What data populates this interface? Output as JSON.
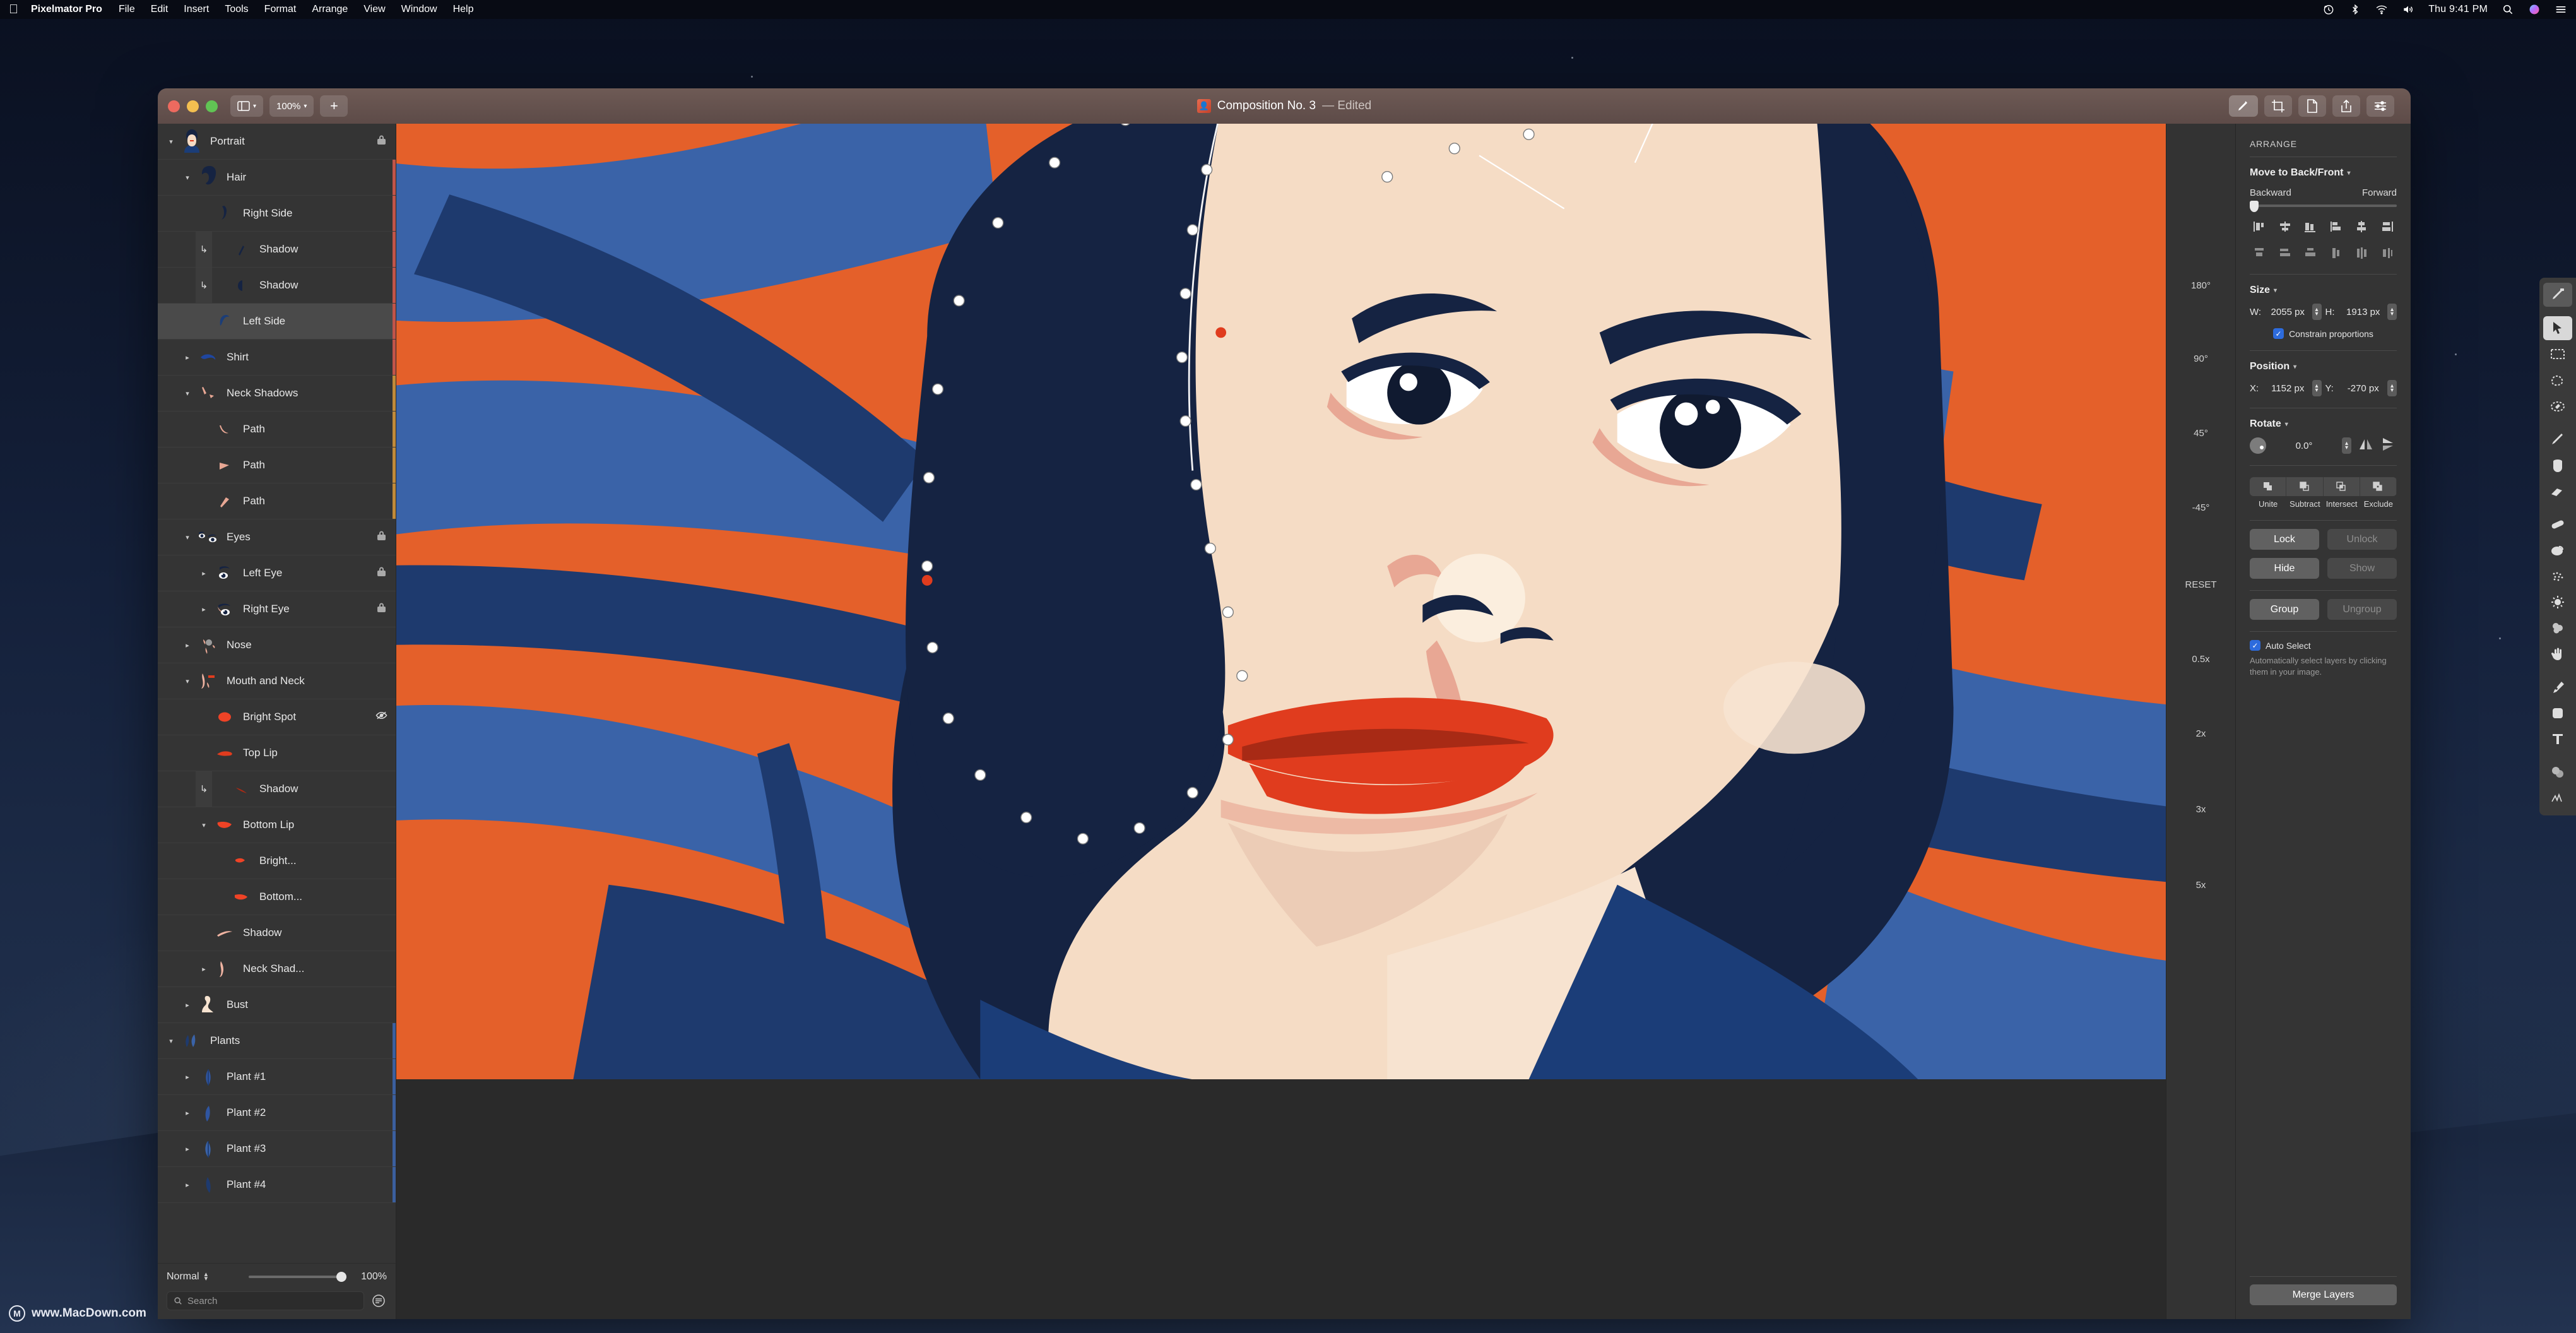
{
  "menubar": {
    "apple": "apple-logo",
    "app_name": "Pixelmator Pro",
    "items": [
      "File",
      "Edit",
      "Insert",
      "Tools",
      "Format",
      "Arrange",
      "View",
      "Window",
      "Help"
    ],
    "status_icons": [
      "time-machine-icon",
      "bluetooth-icon",
      "wifi-icon",
      "volume-icon"
    ],
    "clock": "Thu 9:41 PM",
    "right_icons": [
      "search-icon",
      "siri-icon",
      "control-center-icon"
    ]
  },
  "titlebar": {
    "view_button": "sidebar-toggle",
    "zoom_label": "100%",
    "add_label": "+",
    "doc_name": "Composition No. 3",
    "doc_state": "— Edited",
    "tools": [
      "paint-tool-icon",
      "crop-icon",
      "document-icon",
      "share-icon",
      "sliders-icon"
    ]
  },
  "layers": {
    "rows": [
      {
        "name": "Portrait",
        "indent": 0,
        "disclosure": "down",
        "thumb": "portrait",
        "badge": "lock",
        "clip": false,
        "selected": false,
        "bar": ""
      },
      {
        "name": "Hair",
        "indent": 1,
        "disclosure": "down",
        "thumb": "hair",
        "badge": "",
        "clip": false,
        "selected": false,
        "bar": "#c0544a"
      },
      {
        "name": "Right Side",
        "indent": 2,
        "disclosure": "",
        "thumb": "strand",
        "badge": "",
        "clip": false,
        "selected": false,
        "bar": "#c0544a"
      },
      {
        "name": "Shadow",
        "indent": 2,
        "disclosure": "",
        "thumb": "shadow1",
        "badge": "",
        "clip": true,
        "selected": false,
        "bar": "#c0544a"
      },
      {
        "name": "Shadow",
        "indent": 2,
        "disclosure": "",
        "thumb": "shadow2",
        "badge": "",
        "clip": true,
        "selected": false,
        "bar": "#c0544a"
      },
      {
        "name": "Left Side",
        "indent": 2,
        "disclosure": "",
        "thumb": "leftside",
        "badge": "",
        "clip": false,
        "selected": true,
        "bar": "#c0544a"
      },
      {
        "name": "Shirt",
        "indent": 1,
        "disclosure": "right",
        "thumb": "shirt",
        "badge": "",
        "clip": false,
        "selected": false,
        "bar": "#c0544a"
      },
      {
        "name": "Neck Shadows",
        "indent": 1,
        "disclosure": "down",
        "thumb": "neckshad",
        "badge": "",
        "clip": false,
        "selected": false,
        "bar": "#c08a3a"
      },
      {
        "name": "Path",
        "indent": 2,
        "disclosure": "",
        "thumb": "path1",
        "badge": "",
        "clip": false,
        "selected": false,
        "bar": "#c08a3a"
      },
      {
        "name": "Path",
        "indent": 2,
        "disclosure": "",
        "thumb": "path2",
        "badge": "",
        "clip": false,
        "selected": false,
        "bar": "#c08a3a"
      },
      {
        "name": "Path",
        "indent": 2,
        "disclosure": "",
        "thumb": "path3",
        "badge": "",
        "clip": false,
        "selected": false,
        "bar": "#c08a3a"
      },
      {
        "name": "Eyes",
        "indent": 1,
        "disclosure": "down",
        "thumb": "eyes",
        "badge": "lock",
        "clip": false,
        "selected": false,
        "bar": ""
      },
      {
        "name": "Left Eye",
        "indent": 2,
        "disclosure": "right",
        "thumb": "lefteye",
        "badge": "lock",
        "clip": false,
        "selected": false,
        "bar": ""
      },
      {
        "name": "Right Eye",
        "indent": 2,
        "disclosure": "right",
        "thumb": "righteye",
        "badge": "lock",
        "clip": false,
        "selected": false,
        "bar": ""
      },
      {
        "name": "Nose",
        "indent": 1,
        "disclosure": "right",
        "thumb": "nose",
        "badge": "",
        "clip": false,
        "selected": false,
        "bar": ""
      },
      {
        "name": "Mouth and Neck",
        "indent": 1,
        "disclosure": "down",
        "thumb": "mouthneck",
        "badge": "",
        "clip": false,
        "selected": false,
        "bar": ""
      },
      {
        "name": "Bright Spot",
        "indent": 2,
        "disclosure": "",
        "thumb": "brightspot",
        "badge": "hidden",
        "clip": false,
        "selected": false,
        "bar": ""
      },
      {
        "name": "Top Lip",
        "indent": 2,
        "disclosure": "",
        "thumb": "toplip",
        "badge": "",
        "clip": false,
        "selected": false,
        "bar": ""
      },
      {
        "name": "Shadow",
        "indent": 2,
        "disclosure": "",
        "thumb": "lipshadow",
        "badge": "",
        "clip": true,
        "selected": false,
        "bar": ""
      },
      {
        "name": "Bottom Lip",
        "indent": 2,
        "disclosure": "down",
        "thumb": "bottomlip",
        "badge": "",
        "clip": false,
        "selected": false,
        "bar": ""
      },
      {
        "name": "Bright...",
        "indent": 3,
        "disclosure": "",
        "thumb": "brighthl",
        "badge": "",
        "clip": false,
        "selected": false,
        "bar": ""
      },
      {
        "name": "Bottom...",
        "indent": 3,
        "disclosure": "",
        "thumb": "bottomsh",
        "badge": "",
        "clip": false,
        "selected": false,
        "bar": ""
      },
      {
        "name": "Shadow",
        "indent": 2,
        "disclosure": "",
        "thumb": "neckline",
        "badge": "",
        "clip": false,
        "selected": false,
        "bar": ""
      },
      {
        "name": "Neck Shad...",
        "indent": 2,
        "disclosure": "right",
        "thumb": "neckshad2",
        "badge": "",
        "clip": false,
        "selected": false,
        "bar": ""
      },
      {
        "name": "Bust",
        "indent": 1,
        "disclosure": "right",
        "thumb": "bust",
        "badge": "",
        "clip": false,
        "selected": false,
        "bar": ""
      },
      {
        "name": "Plants",
        "indent": 0,
        "disclosure": "down",
        "thumb": "plants",
        "badge": "",
        "clip": false,
        "selected": false,
        "bar": "#3b5f9e"
      },
      {
        "name": "Plant #1",
        "indent": 1,
        "disclosure": "right",
        "thumb": "plant1",
        "badge": "",
        "clip": false,
        "selected": false,
        "bar": "#3b5f9e"
      },
      {
        "name": "Plant #2",
        "indent": 1,
        "disclosure": "right",
        "thumb": "plant2",
        "badge": "",
        "clip": false,
        "selected": false,
        "bar": "#3b5f9e"
      },
      {
        "name": "Plant #3",
        "indent": 1,
        "disclosure": "right",
        "thumb": "plant3",
        "badge": "",
        "clip": false,
        "selected": false,
        "bar": "#3b5f9e"
      },
      {
        "name": "Plant #4",
        "indent": 1,
        "disclosure": "right",
        "thumb": "plant4",
        "badge": "",
        "clip": false,
        "selected": false,
        "bar": "#3b5f9e"
      }
    ],
    "blend_mode": "Normal",
    "opacity": "100%",
    "search_placeholder": "Search",
    "filter_icon": "filter-icon"
  },
  "rail": {
    "items": [
      "180°",
      "90°",
      "45°",
      "-45°",
      "RESET",
      "0.5x",
      "2x",
      "3x",
      "5x"
    ]
  },
  "inspector": {
    "title": "ARRANGE",
    "move_label": "Move to Back/Front",
    "backward": "Backward",
    "forward": "Forward",
    "size_label": "Size",
    "w_label": "W:",
    "w_value": "2055 px",
    "h_label": "H:",
    "h_value": "1913 px",
    "constrain_label": "Constrain proportions",
    "position_label": "Position",
    "x_label": "X:",
    "x_value": "1152 px",
    "y_label": "Y:",
    "y_value": "-270 px",
    "rotate_label": "Rotate",
    "angle_value": "0.0°",
    "flip_h_icon": "flip-horizontal-icon",
    "flip_v_icon": "flip-vertical-icon",
    "bool_labels": [
      "Unite",
      "Subtract",
      "Intersect",
      "Exclude"
    ],
    "lock": "Lock",
    "unlock": "Unlock",
    "hide": "Hide",
    "show": "Show",
    "group": "Group",
    "ungroup": "Ungroup",
    "auto_select": "Auto Select",
    "auto_select_help": "Automatically select layers by clicking them in your image.",
    "merge_layers": "Merge Layers"
  },
  "tools": {
    "items": [
      "retouch-tool-icon",
      "arrange-tool-icon",
      "rect-select-icon",
      "free-select-icon",
      "magic-wand-icon",
      "paint-brush-icon",
      "paint-bucket-icon",
      "eraser-icon",
      "repair-icon",
      "clone-icon",
      "pixelate-icon",
      "lighten-icon",
      "smudge-icon",
      "hand-icon",
      "pen-icon",
      "shape-icon",
      "type-icon",
      "color-adjust-icon",
      "effects-icon"
    ]
  },
  "watermark": {
    "text": "www.MacDown.com",
    "mark": "M"
  },
  "colors": {
    "accent": "#2d6bdd",
    "canvas_orange": "#e4602a",
    "canvas_blue_dark": "#1e3a6e",
    "canvas_blue_mid": "#3a63a8",
    "hair": "#152342",
    "skin": "#f5dcc5",
    "lips": "#e03c1e"
  }
}
